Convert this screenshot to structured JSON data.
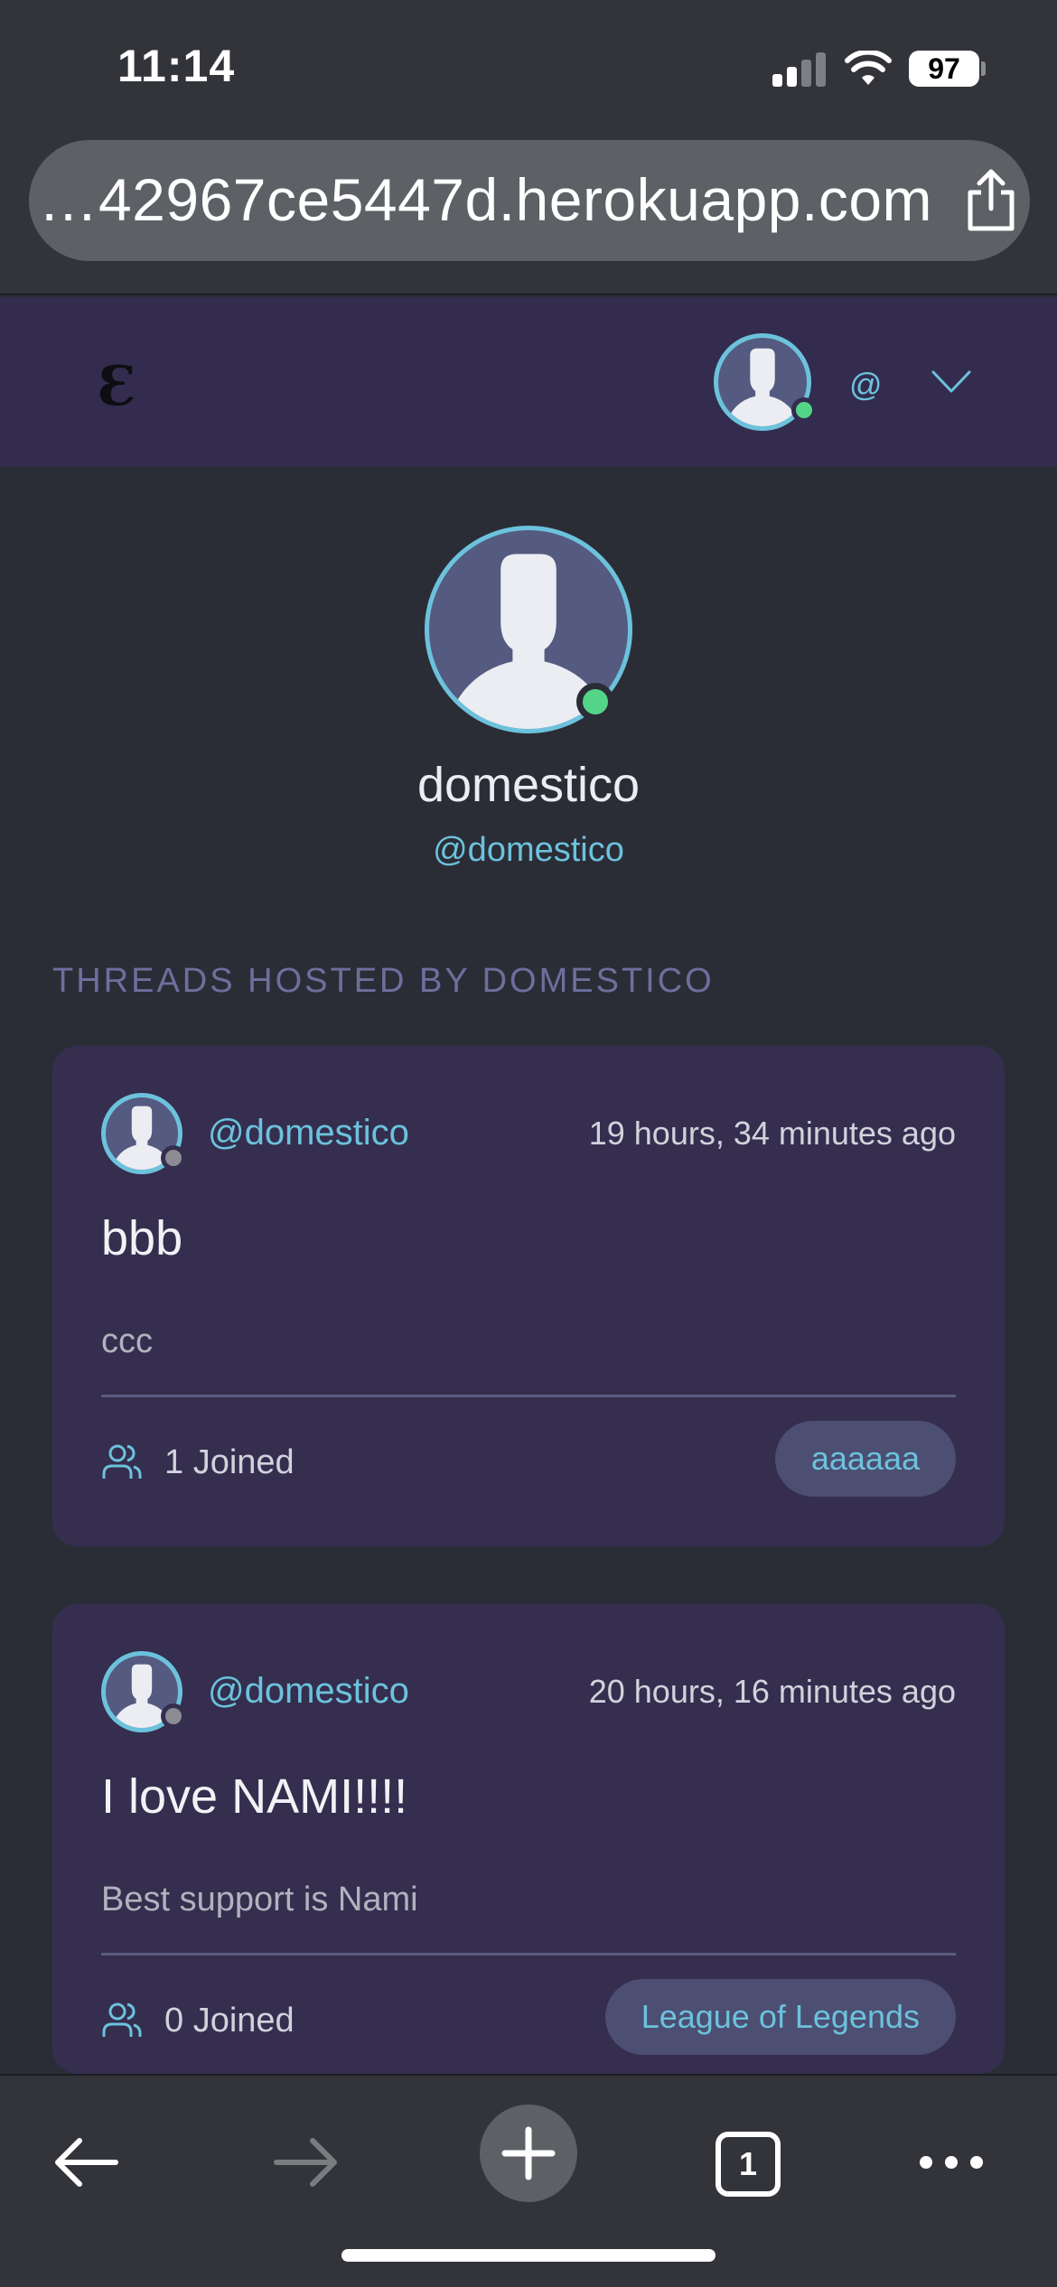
{
  "status_bar": {
    "time": "11:14",
    "battery": "97"
  },
  "browser": {
    "url": "…42967ce5447d.herokuapp.com",
    "tab_count": "1"
  },
  "header": {
    "logo": "Ɛ",
    "user_at": "@"
  },
  "profile": {
    "name": "domestico",
    "handle": "@domestico",
    "online": true
  },
  "section_title": "THREADS HOSTED BY DOMESTICO",
  "threads": [
    {
      "handle": "@domestico",
      "time": "19 hours, 34 minutes ago",
      "title": "bbb",
      "description": "ccc",
      "joined": "1 Joined",
      "tag": "aaaaaa"
    },
    {
      "handle": "@domestico",
      "time": "20 hours, 16 minutes ago",
      "title": "I love NAMI!!!!",
      "description": "Best support is Nami",
      "joined": "0 Joined",
      "tag": "League of Legends"
    }
  ],
  "colors": {
    "accent": "#6cc2dc",
    "online": "#54d488",
    "offline": "#8c8c94",
    "header_bg": "#332c4e",
    "card_bg": "#352e4f",
    "page_bg": "#2b2d36"
  },
  "icons": [
    "signal-icon",
    "wifi-icon",
    "battery-icon",
    "share-icon",
    "chevron-down-icon",
    "users-icon",
    "back-arrow-icon",
    "forward-arrow-icon",
    "plus-icon",
    "tabs-icon",
    "more-icon"
  ]
}
